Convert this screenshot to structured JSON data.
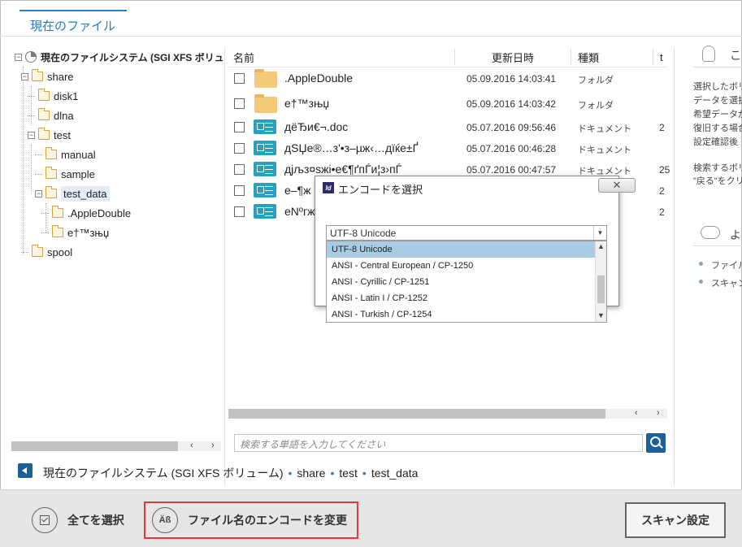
{
  "tab": {
    "label": "現在のファイル"
  },
  "tree": {
    "root": "現在のファイルシステム (SGI XFS ボリューム",
    "share": "share",
    "disk1": "disk1",
    "dlna": "dlna",
    "test": "test",
    "manual": "manual",
    "sample": "sample",
    "test_data": "test_data",
    "appledouble": ".AppleDouble",
    "etm": "e†™зњџ",
    "spool": "spool"
  },
  "columns": {
    "name": "名前",
    "date": "更新日時",
    "type": "種類",
    "size": "t"
  },
  "files": [
    {
      "name": ".AppleDouble",
      "date": "05.09.2016 14:03:41",
      "type": "フォルダ",
      "size": "",
      "kind": "folder"
    },
    {
      "name": "e†™зњџ",
      "date": "05.09.2016 14:03:42",
      "type": "フォルダ",
      "size": "",
      "kind": "folder"
    },
    {
      "name": "дёЂи€¬.doc",
      "date": "05.07.2016 09:56:46",
      "type": "ドキュメント",
      "size": "2",
      "kind": "doc"
    },
    {
      "name": "дЅЏе®…з'•з–µж‹…дїќе±Ґ",
      "date": "05.07.2016 00:46:28",
      "type": "ドキュメント",
      "size": "",
      "kind": "doc"
    },
    {
      "name": "дјљз¤ѕжі•е€¶ґпЃи¦з›пЃ",
      "date": "05.07.2016 00:47:57",
      "type": "ドキュメント",
      "size": "25",
      "kind": "doc"
    },
    {
      "name": "е–¶ж",
      "date": "",
      "type": "",
      "size": "2",
      "kind": "doc"
    },
    {
      "name": "eNºгж",
      "date": "",
      "type": "",
      "size": "2",
      "kind": "doc"
    }
  ],
  "right_panel": {
    "heading1": "こ",
    "lines": [
      "選択したボリ",
      "データを選択",
      "希望データが",
      "復旧する場合",
      "設定確認後"
    ],
    "lines2": [
      "検索するボリ",
      "\"戻る\"をクリッ"
    ],
    "heading2": "よ",
    "bullets": [
      "ファイルネ",
      "スキャン"
    ]
  },
  "search": {
    "placeholder": "検索する単語を入力してください"
  },
  "breadcrumb": [
    "現在のファイルシステム (SGI XFS ボリューム)",
    "share",
    "test",
    "test_data"
  ],
  "bottom": {
    "select_all": "全てを選択",
    "change_encoding": "ファイル名のエンコードを変更",
    "encoding_icon": "Äß",
    "scan_settings": "スキャン設定"
  },
  "dialog": {
    "app_icon": "Id",
    "title": "エンコードを選択",
    "close": "✕",
    "selected": "UTF-8 Unicode",
    "options": [
      "UTF-8 Unicode",
      "ANSI - Central European / CP-1250",
      "ANSI - Cyrillic / CP-1251",
      "ANSI - Latin I / CP-1252",
      "ANSI - Turkish / CP-1254"
    ]
  }
}
